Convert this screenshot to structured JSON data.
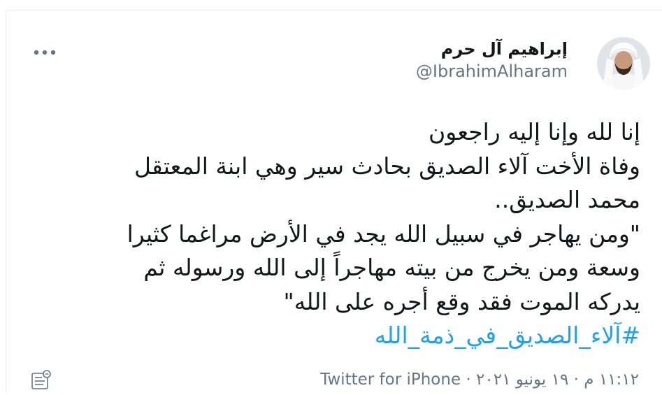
{
  "user": {
    "display_name": "إبراهيم آل حرم",
    "handle": "@IbrahimAlharam",
    "avatar_icon": "profile-photo-man-in-ghutra"
  },
  "tweet": {
    "lines": [
      "إنا لله وإنا إليه راجعون",
      "وفاة الأخت آلاء الصديق بحادث سير وهي ابنة المعتقل",
      "محمد الصديق..",
      "\"ومن يهاجر في سبيل الله يجد في الأرض مراغما كثيرا",
      "وسعة ومن يخرج من بيته مهاجراً إلى الله ورسوله ثم",
      "يدركه الموت فقد وقع أجره على الله\""
    ],
    "hashtag": "#آلاء_الصديق_في_ذمة_الله"
  },
  "meta": {
    "time": "١١:١٢ م",
    "separator": "·",
    "date": "١٩ يونيو ٢٠٢١",
    "source": "Twitter for iPhone"
  },
  "icons": {
    "more": "more-horizontal-icon",
    "notes": "notes-icon"
  },
  "colors": {
    "text": "#14171a",
    "secondary": "#657786",
    "link": "#1da1f2",
    "border": "#e6ecf0"
  }
}
